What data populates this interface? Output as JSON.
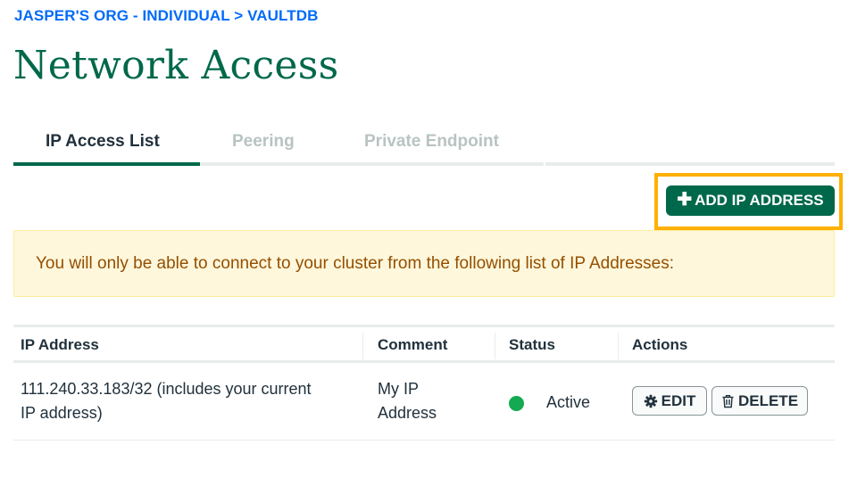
{
  "breadcrumb": "JASPER'S ORG - INDIVIDUAL > VAULTDB",
  "page_title": "Network Access",
  "tabs": [
    {
      "label": "IP Access List",
      "active": true
    },
    {
      "label": "Peering",
      "active": false
    },
    {
      "label": "Private Endpoint",
      "active": false
    }
  ],
  "add_button": {
    "icon": "plus-icon",
    "label": "ADD IP ADDRESS"
  },
  "banner": {
    "text": "You will only be able to connect to your cluster from the following list of IP Addresses:"
  },
  "table": {
    "columns": [
      "IP Address",
      "Comment",
      "Status",
      "Actions"
    ],
    "rows": [
      {
        "ip_line1": "111.240.33.183/32  (includes your current",
        "ip_line2": "IP address)",
        "comment_line1": "My IP",
        "comment_line2": "Address",
        "status": "Active",
        "edit_label": "EDIT",
        "delete_label": "DELETE"
      }
    ]
  },
  "colors": {
    "brand_green": "#00684a",
    "link_blue": "#016bf8",
    "highlight": "#ffb000",
    "status_active": "#13aa52",
    "banner_bg": "#fef7db"
  }
}
